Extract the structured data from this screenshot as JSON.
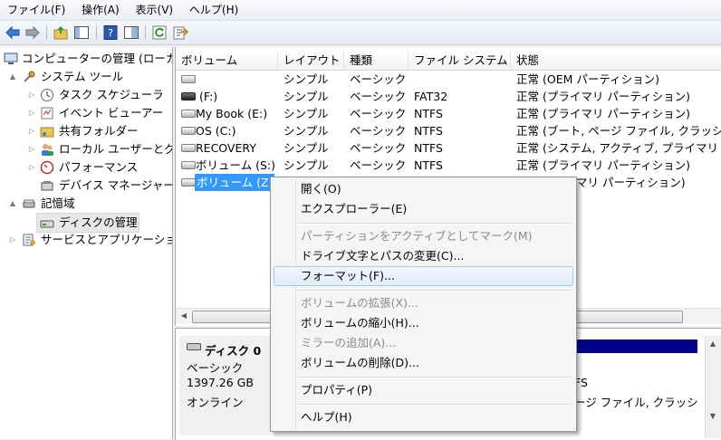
{
  "menubar": {
    "items": [
      "ファイル(F)",
      "操作(A)",
      "表示(V)",
      "ヘルプ(H)"
    ]
  },
  "toolbar": {
    "icons": [
      "back-arrow-icon",
      "forward-arrow-icon",
      "up-folder-icon",
      "console-tree-icon",
      "help-icon",
      "properties-panel-icon",
      "refresh-icon",
      "export-icon"
    ]
  },
  "tree": {
    "items": [
      {
        "label": "コンピューターの管理 (ローカ",
        "level": 0,
        "expander": ""
      },
      {
        "label": "システム ツール",
        "level": 1,
        "expander": "▲"
      },
      {
        "label": "タスク スケジューラ",
        "level": 2,
        "expander": "▷"
      },
      {
        "label": "イベント ビューアー",
        "level": 2,
        "expander": "▷"
      },
      {
        "label": "共有フォルダー",
        "level": 2,
        "expander": "▷"
      },
      {
        "label": "ローカル ユーザーとグ",
        "level": 2,
        "expander": "▷"
      },
      {
        "label": "パフォーマンス",
        "level": 2,
        "expander": "▷"
      },
      {
        "label": "デバイス マネージャー",
        "level": 2,
        "expander": ""
      },
      {
        "label": "記憶域",
        "level": 1,
        "expander": "▲"
      },
      {
        "label": "ディスクの管理",
        "level": 2,
        "expander": ""
      },
      {
        "label": "サービスとアプリケーショ",
        "level": 1,
        "expander": "▷"
      }
    ]
  },
  "volumes": {
    "columns": [
      "ボリューム",
      "レイアウト",
      "種類",
      "ファイル システム",
      "状態"
    ],
    "rows": [
      {
        "name": "",
        "layout": "シンプル",
        "type": "ベーシック",
        "fs": "",
        "status": "正常 (OEM パーティション)",
        "dark": false
      },
      {
        "name": "(F:)",
        "layout": "シンプル",
        "type": "ベーシック",
        "fs": "FAT32",
        "status": "正常 (プライマリ パーティション)",
        "dark": true
      },
      {
        "name": "My Book (E:)",
        "layout": "シンプル",
        "type": "ベーシック",
        "fs": "NTFS",
        "status": "正常 (プライマリ パーティション)",
        "dark": false
      },
      {
        "name": "OS (C:)",
        "layout": "シンプル",
        "type": "ベーシック",
        "fs": "NTFS",
        "status": "正常 (ブート, ページ ファイル, クラッシ",
        "dark": false
      },
      {
        "name": "RECOVERY",
        "layout": "シンプル",
        "type": "ベーシック",
        "fs": "NTFS",
        "status": "正常 (システム, アクティブ, プライマリ",
        "dark": false
      },
      {
        "name": "ボリューム (S:)",
        "layout": "シンプル",
        "type": "ベーシック",
        "fs": "NTFS",
        "status": "正常 (プライマリ パーティション)",
        "dark": false
      },
      {
        "name": "ボリューム (Z:",
        "layout": "",
        "type": "",
        "fs": "",
        "status": "マリ パーティション)",
        "dark": false,
        "selected": true
      }
    ]
  },
  "disk": {
    "name": "ディスク 0",
    "type": "ベーシック",
    "size": "1397.26 GB",
    "state": "オンライン",
    "partition_fs": "FS",
    "partition_status": "ージ ファイル, クラッシ"
  },
  "context_menu": {
    "items": [
      {
        "label": "開く(O)",
        "enabled": true
      },
      {
        "label": "エクスプローラー(E)",
        "enabled": true
      },
      {
        "separator": true
      },
      {
        "label": "パーティションをアクティブとしてマーク(M)",
        "enabled": false
      },
      {
        "label": "ドライブ文字とパスの変更(C)...",
        "enabled": true
      },
      {
        "label": "フォーマット(F)...",
        "enabled": true,
        "highlighted": true
      },
      {
        "separator": true
      },
      {
        "label": "ボリュームの拡張(X)...",
        "enabled": false
      },
      {
        "label": "ボリュームの縮小(H)...",
        "enabled": true
      },
      {
        "label": "ミラーの追加(A)...",
        "enabled": false
      },
      {
        "label": "ボリュームの削除(D)...",
        "enabled": true
      },
      {
        "separator": true
      },
      {
        "label": "プロパティ(P)",
        "enabled": true
      },
      {
        "separator": true
      },
      {
        "label": "ヘルプ(H)",
        "enabled": true
      }
    ]
  },
  "colors": {
    "selection": "#3399ff",
    "disk_bar": "#00008b",
    "menu_hover_border": "#a8c8ef"
  }
}
